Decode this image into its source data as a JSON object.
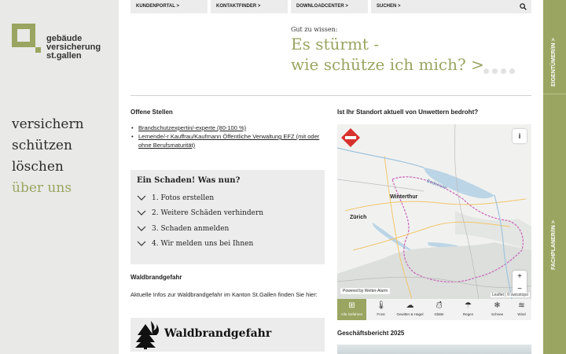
{
  "brand": {
    "line1": "gebäude",
    "line2": "versicherung",
    "line3": "st.gallen",
    "color": "#9aa561"
  },
  "nav": {
    "items": [
      "versichern",
      "schützen",
      "löschen",
      "über uns"
    ],
    "active_index": 3
  },
  "topbar": {
    "kundenportal": "KUNDENPORTAL >",
    "kontaktfinder": "KONTAKTFINDER >",
    "downloadcenter": "DOWNLOADCENTER >",
    "suchen": "SUCHEN >",
    "search_icon": "search-icon"
  },
  "sidetabs": {
    "owners": "EIGENTÜMER/IN >",
    "specialists": "FACHPLANER/IN >"
  },
  "hero": {
    "pre": "Gut zu wissen:",
    "title_line1": "Es stürmt -",
    "title_line2": "wie schütze ich mich? >",
    "slide_count": 4
  },
  "jobs": {
    "heading": "Offene Stellen",
    "items": [
      "Brandschutzexpertin/-experte (80-100 %)",
      "Lernende/-r Kauffrau/Kaufmann Öffentliche Verwaltung EFZ (mit oder ohne Berufsmaturität)"
    ]
  },
  "damage": {
    "title": "Ein Schaden! Was nun?",
    "steps": [
      "1. Fotos erstellen",
      "2. Weitere Schäden verhindern",
      "3. Schaden anmelden",
      "4. Wir melden uns bei Ihnen"
    ]
  },
  "forest": {
    "heading": "Waldbrandgefahr",
    "text": "Aktuelle Infos zur Waldbrandgefahr im Kanton St.Gallen finden Sie hier:",
    "box_label": "Waldbrandgefahr"
  },
  "map": {
    "heading": "Ist Ihr Standort aktuell von Unwettern bedroht?",
    "info": "i",
    "zoom_in": "+",
    "zoom_out": "−",
    "cities": [
      "Winterthur",
      "Zürich"
    ],
    "powered": "Powered by Wetter-Alarm",
    "credit": "Leaflet | © swisstopo",
    "lake_label": "Bodensee"
  },
  "filters": {
    "items": [
      {
        "label": "Alle Gefahren",
        "icon": "grid-icon"
      },
      {
        "label": "Frost",
        "icon": "thermometer-icon"
      },
      {
        "label": "Gewitter & Hagel",
        "icon": "storm-cloud-icon"
      },
      {
        "label": "Glätte",
        "icon": "ice-icon"
      },
      {
        "label": "Regen",
        "icon": "umbrella-icon"
      },
      {
        "label": "Schnee",
        "icon": "snow-cloud-icon"
      },
      {
        "label": "Wind",
        "icon": "wind-icon"
      }
    ],
    "active_index": 0
  },
  "report": {
    "heading": "Geschäftsbericht 2025"
  }
}
